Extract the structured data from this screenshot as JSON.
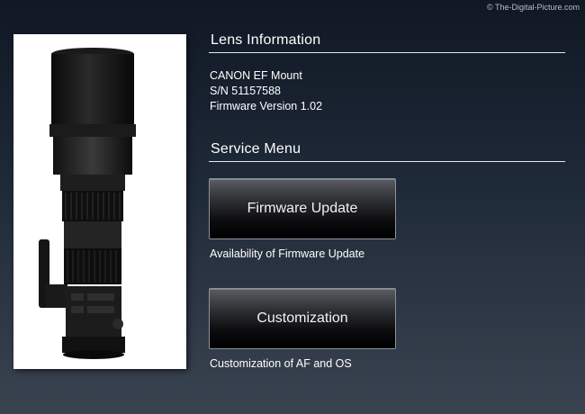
{
  "watermark": "© The-Digital-Picture.com",
  "lens_info": {
    "heading": "Lens Information",
    "mount": "CANON EF Mount",
    "serial": "S/N 51157588",
    "firmware": "Firmware Version 1.02"
  },
  "service_menu": {
    "heading": "Service Menu",
    "firmware_update": {
      "label": "Firmware Update",
      "description": "Availability of Firmware Update"
    },
    "customization": {
      "label": "Customization",
      "description": "Customization of AF and OS"
    }
  },
  "colors": {
    "background_top": "#101824",
    "background_bottom": "#3a4350",
    "rule": "#e6e9ee",
    "button_top": "#5a5d62",
    "button_bottom": "#000000"
  }
}
